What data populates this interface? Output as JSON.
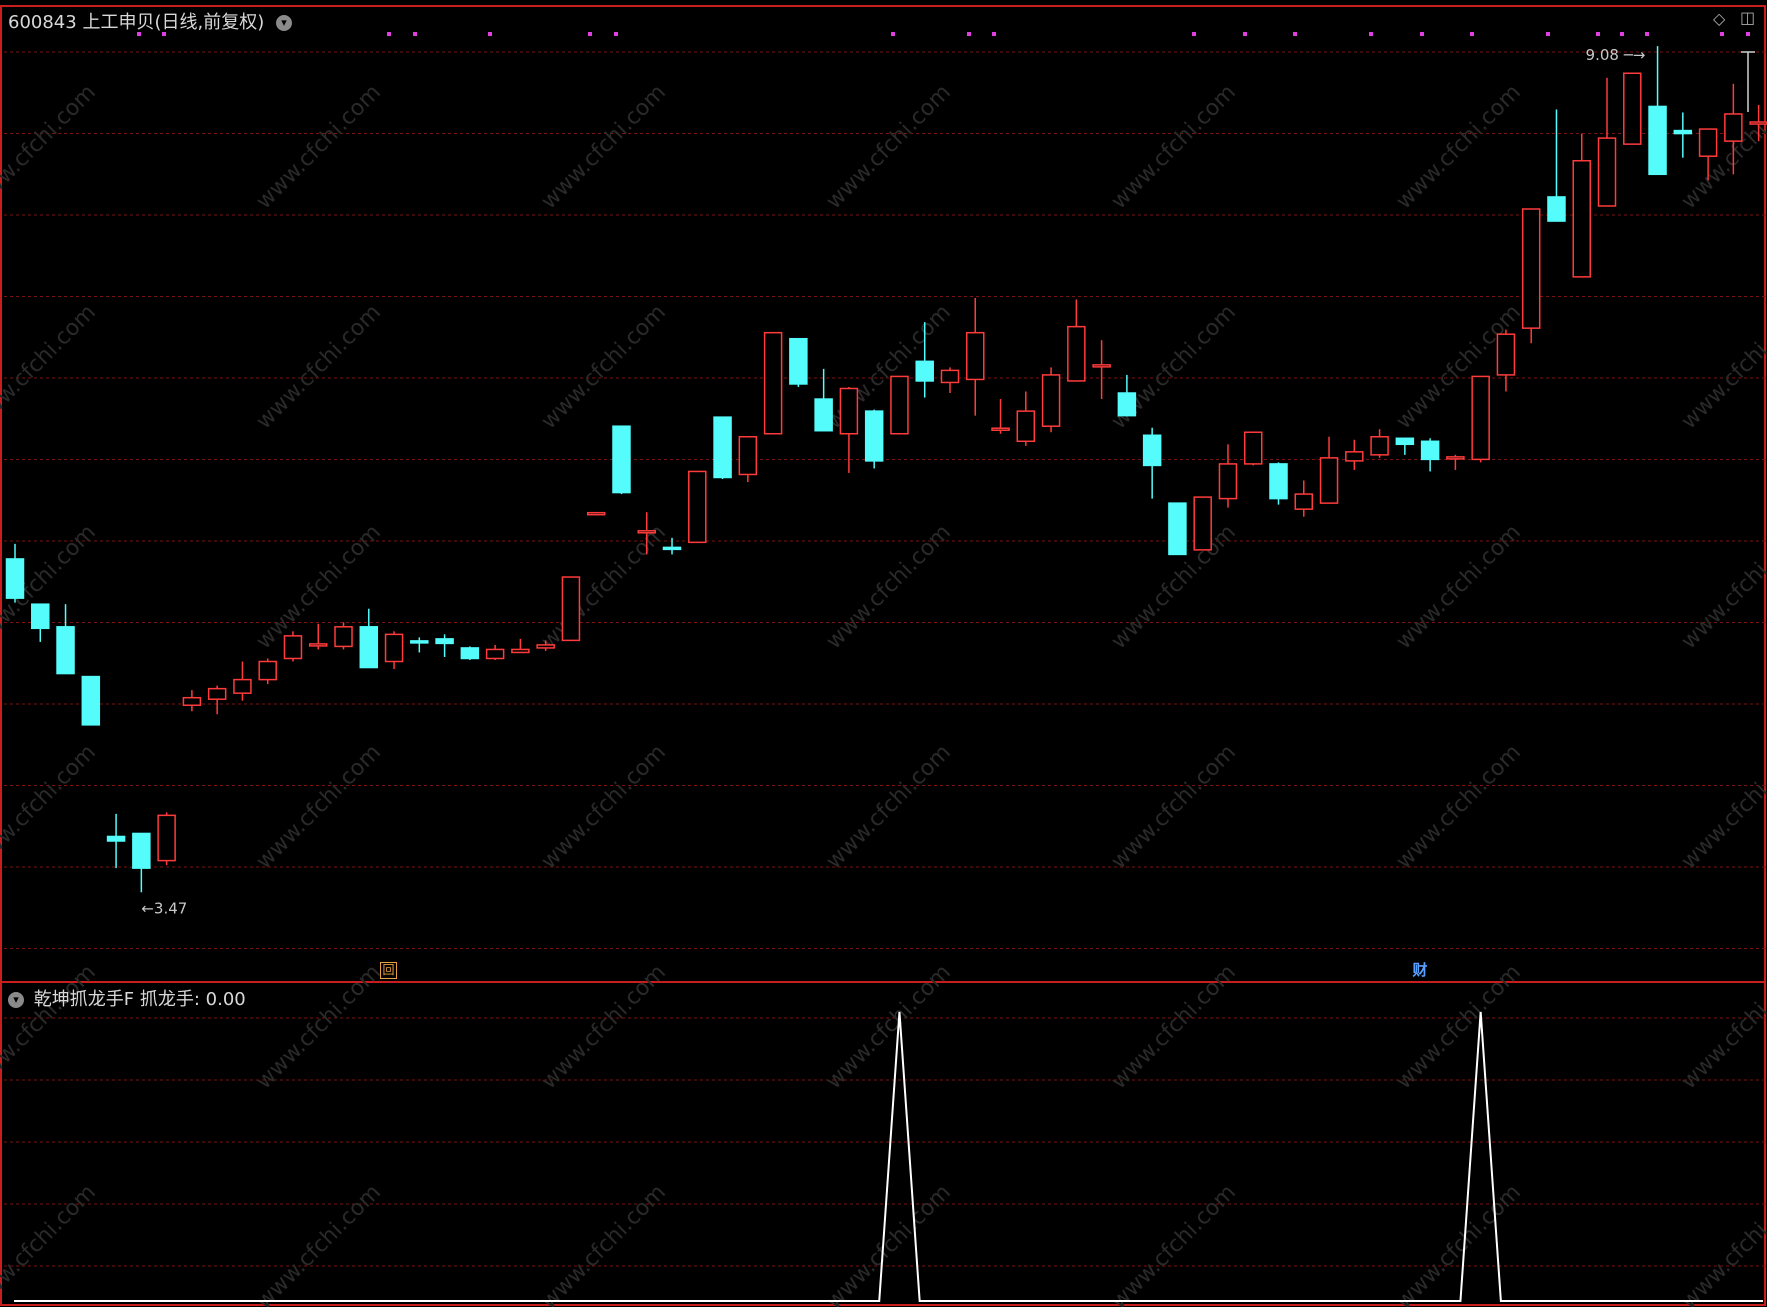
{
  "header": {
    "code": "600843",
    "name": "上工申贝",
    "mode": "(日线,前复权)"
  },
  "indicator": {
    "name": "乾坤抓龙手F",
    "label": "抓龙手:",
    "value": "0.00"
  },
  "markers": {
    "hui": "回",
    "cai": "财"
  },
  "watermark": "www.cfchi.com",
  "colors": {
    "up": "#ff3b3b",
    "down": "#54fcfc",
    "grid": "#7a1414",
    "border": "#c81e1e",
    "signal": "#ffffff",
    "dots": "#e040e0"
  },
  "icons": [
    "chevron-down-icon",
    "diamond-icon",
    "window-icon"
  ],
  "chart_data": [
    {
      "type": "candlestick",
      "title": "600843 上工申贝(日线,前复权)",
      "ylim": [
        3.2,
        9.2
      ],
      "high_label": "9.08",
      "low_label": "3.47",
      "candles": [
        {
          "o": 5.68,
          "h": 5.78,
          "l": 5.39,
          "c": 5.42
        },
        {
          "o": 5.38,
          "h": 5.38,
          "l": 5.13,
          "c": 5.22
        },
        {
          "o": 5.23,
          "h": 5.38,
          "l": 4.92,
          "c": 4.92
        },
        {
          "o": 4.9,
          "h": 4.9,
          "l": 4.6,
          "c": 4.58
        },
        {
          "o": 3.84,
          "h": 3.99,
          "l": 3.63,
          "c": 3.81
        },
        {
          "o": 3.86,
          "h": 3.86,
          "l": 3.47,
          "c": 3.63
        },
        {
          "o": 3.68,
          "h": 4.0,
          "l": 3.65,
          "c": 3.98
        },
        {
          "o": 4.71,
          "h": 4.81,
          "l": 4.67,
          "c": 4.76
        },
        {
          "o": 4.75,
          "h": 4.84,
          "l": 4.65,
          "c": 4.82
        },
        {
          "o": 4.79,
          "h": 5.0,
          "l": 4.74,
          "c": 4.88
        },
        {
          "o": 4.88,
          "h": 5.02,
          "l": 4.85,
          "c": 5.0
        },
        {
          "o": 5.02,
          "h": 5.2,
          "l": 5.0,
          "c": 5.17
        },
        {
          "o": 5.1,
          "h": 5.25,
          "l": 5.08,
          "c": 5.11
        },
        {
          "o": 5.1,
          "h": 5.26,
          "l": 5.08,
          "c": 5.23
        },
        {
          "o": 5.23,
          "h": 5.35,
          "l": 4.96,
          "c": 4.96
        },
        {
          "o": 5.0,
          "h": 5.2,
          "l": 4.95,
          "c": 5.18
        },
        {
          "o": 5.13,
          "h": 5.16,
          "l": 5.06,
          "c": 5.12
        },
        {
          "o": 5.15,
          "h": 5.18,
          "l": 5.03,
          "c": 5.12
        },
        {
          "o": 5.09,
          "h": 5.1,
          "l": 5.01,
          "c": 5.02
        },
        {
          "o": 5.02,
          "h": 5.11,
          "l": 5.01,
          "c": 5.08
        },
        {
          "o": 5.06,
          "h": 5.15,
          "l": 5.06,
          "c": 5.08
        },
        {
          "o": 5.09,
          "h": 5.14,
          "l": 5.07,
          "c": 5.11
        },
        {
          "o": 5.14,
          "h": 5.56,
          "l": 5.14,
          "c": 5.56
        },
        {
          "o": 5.98,
          "h": 5.98,
          "l": 5.98,
          "c": 5.98
        },
        {
          "o": 6.56,
          "h": 6.56,
          "l": 6.11,
          "c": 6.12
        },
        {
          "o": 5.86,
          "h": 5.99,
          "l": 5.71,
          "c": 5.86
        },
        {
          "o": 5.75,
          "h": 5.82,
          "l": 5.71,
          "c": 5.74
        },
        {
          "o": 5.79,
          "h": 6.26,
          "l": 5.79,
          "c": 6.26
        },
        {
          "o": 6.62,
          "h": 6.62,
          "l": 6.21,
          "c": 6.22
        },
        {
          "o": 6.24,
          "h": 6.49,
          "l": 6.19,
          "c": 6.49
        },
        {
          "o": 6.51,
          "h": 7.18,
          "l": 6.51,
          "c": 7.18
        },
        {
          "o": 7.14,
          "h": 7.14,
          "l": 6.82,
          "c": 6.84
        },
        {
          "o": 6.74,
          "h": 6.94,
          "l": 6.53,
          "c": 6.53
        },
        {
          "o": 6.51,
          "h": 6.82,
          "l": 6.25,
          "c": 6.81
        },
        {
          "o": 6.66,
          "h": 6.67,
          "l": 6.28,
          "c": 6.33
        },
        {
          "o": 6.51,
          "h": 6.89,
          "l": 6.51,
          "c": 6.89
        },
        {
          "o": 6.99,
          "h": 7.25,
          "l": 6.75,
          "c": 6.86
        },
        {
          "o": 6.85,
          "h": 6.95,
          "l": 6.78,
          "c": 6.93
        },
        {
          "o": 6.87,
          "h": 7.41,
          "l": 6.63,
          "c": 7.18
        },
        {
          "o": 6.54,
          "h": 6.74,
          "l": 6.51,
          "c": 6.54
        },
        {
          "o": 6.46,
          "h": 6.79,
          "l": 6.43,
          "c": 6.66
        },
        {
          "o": 6.56,
          "h": 6.95,
          "l": 6.52,
          "c": 6.9
        },
        {
          "o": 6.86,
          "h": 7.4,
          "l": 6.86,
          "c": 7.22
        },
        {
          "o": 6.96,
          "h": 7.13,
          "l": 6.74,
          "c": 6.96
        },
        {
          "o": 6.78,
          "h": 6.9,
          "l": 6.64,
          "c": 6.63
        },
        {
          "o": 6.5,
          "h": 6.55,
          "l": 6.08,
          "c": 6.3
        },
        {
          "o": 6.05,
          "h": 6.05,
          "l": 5.71,
          "c": 5.71
        },
        {
          "o": 5.74,
          "h": 6.09,
          "l": 5.74,
          "c": 6.09
        },
        {
          "o": 6.08,
          "h": 6.44,
          "l": 6.02,
          "c": 6.31
        },
        {
          "o": 6.31,
          "h": 6.52,
          "l": 6.3,
          "c": 6.52
        },
        {
          "o": 6.31,
          "h": 6.32,
          "l": 6.04,
          "c": 6.08
        },
        {
          "o": 6.01,
          "h": 6.2,
          "l": 5.96,
          "c": 6.11
        },
        {
          "o": 6.05,
          "h": 6.49,
          "l": 6.05,
          "c": 6.35
        },
        {
          "o": 6.33,
          "h": 6.47,
          "l": 6.27,
          "c": 6.39
        },
        {
          "o": 6.37,
          "h": 6.54,
          "l": 6.35,
          "c": 6.49
        },
        {
          "o": 6.48,
          "h": 6.48,
          "l": 6.37,
          "c": 6.44
        },
        {
          "o": 6.46,
          "h": 6.48,
          "l": 6.26,
          "c": 6.34
        },
        {
          "o": 6.35,
          "h": 6.37,
          "l": 6.27,
          "c": 6.35
        },
        {
          "o": 6.34,
          "h": 6.89,
          "l": 6.32,
          "c": 6.89
        },
        {
          "o": 6.9,
          "h": 7.2,
          "l": 6.79,
          "c": 7.17
        },
        {
          "o": 7.21,
          "h": 8.0,
          "l": 7.11,
          "c": 8.0
        },
        {
          "o": 8.08,
          "h": 8.66,
          "l": 7.94,
          "c": 7.92
        },
        {
          "o": 7.55,
          "h": 8.5,
          "l": 7.55,
          "c": 8.32
        },
        {
          "o": 8.02,
          "h": 8.87,
          "l": 8.07,
          "c": 8.47
        },
        {
          "o": 8.43,
          "h": 8.9,
          "l": 8.43,
          "c": 8.9
        },
        {
          "o": 8.68,
          "h": 9.08,
          "l": 8.37,
          "c": 8.23
        },
        {
          "o": 8.52,
          "h": 8.64,
          "l": 8.34,
          "c": 8.5
        },
        {
          "o": 8.35,
          "h": 8.46,
          "l": 8.19,
          "c": 8.53
        },
        {
          "o": 8.45,
          "h": 8.83,
          "l": 8.23,
          "c": 8.63
        },
        {
          "o": 8.57,
          "h": 8.69,
          "l": 8.45,
          "c": 8.57
        }
      ]
    },
    {
      "type": "line",
      "title": "乾坤抓龙手F",
      "series": [
        {
          "name": "抓龙手",
          "points": [
            [
              0,
              0
            ],
            [
              34.2,
              0
            ],
            [
              35,
              1
            ],
            [
              35.8,
              0
            ],
            [
              57.2,
              0
            ],
            [
              58,
              1
            ],
            [
              58.8,
              0
            ],
            [
              69,
              0
            ]
          ]
        }
      ],
      "ylim": [
        0,
        1
      ]
    }
  ]
}
